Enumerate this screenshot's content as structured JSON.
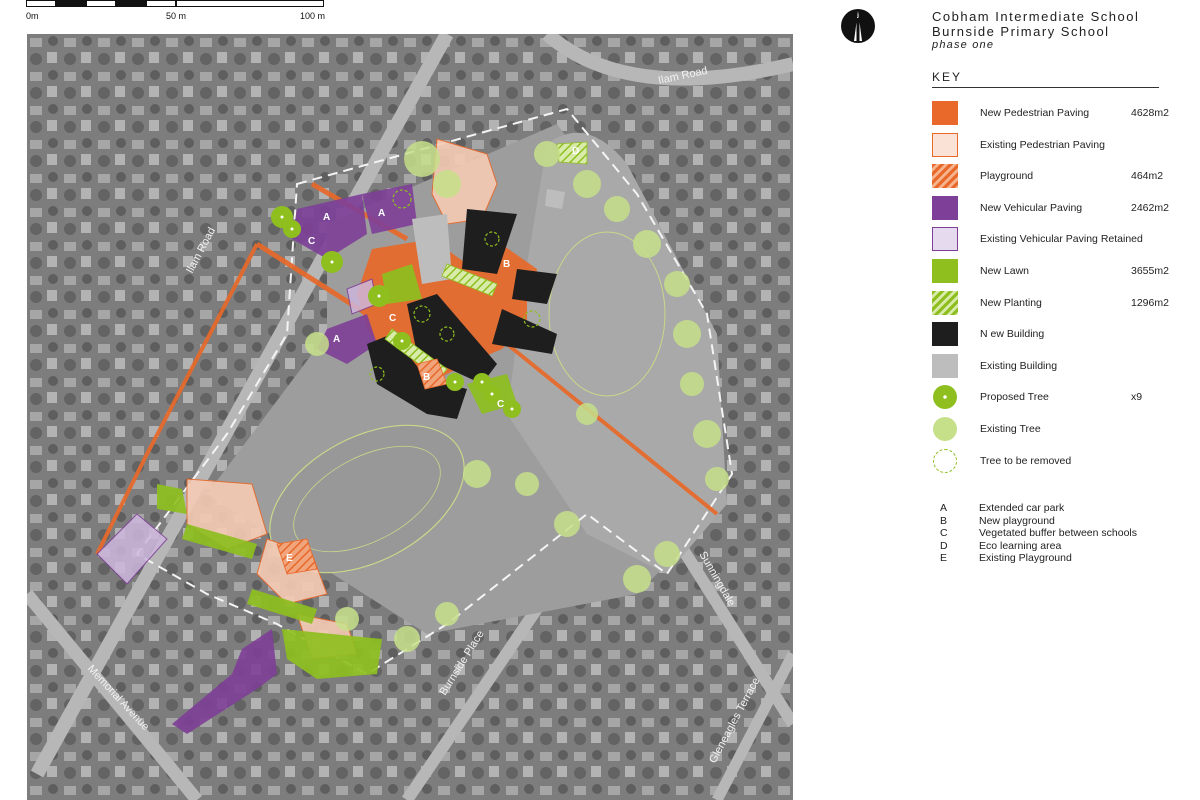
{
  "scale_bar": {
    "labels": [
      "0m",
      "50 m",
      "100 m"
    ]
  },
  "north_label": "N",
  "title": {
    "line1": "Cobham Intermediate School",
    "line2": "Burnside Primary School",
    "phase": "phase one"
  },
  "key": {
    "heading": "KEY",
    "items": [
      {
        "label": "New Pedestrian Paving",
        "value": "4628m2",
        "color": "#e8692a",
        "icon": "solid-swatch"
      },
      {
        "label": "Existing Pedestrian Paving",
        "value": "",
        "color": "#fbe2d6",
        "border": "#e8692a",
        "icon": "outlined-swatch"
      },
      {
        "label": "Playground",
        "value": "464m2",
        "color": "#e8692a",
        "icon": "hatched-swatch"
      },
      {
        "label": "New Vehicular Paving",
        "value": "2462m2",
        "color": "#7e3f98",
        "icon": "solid-swatch"
      },
      {
        "label": "Existing Vehicular Paving Retained",
        "value": "",
        "color": "#e6dbee",
        "border": "#7e3f98",
        "icon": "outlined-swatch"
      },
      {
        "label": "New Lawn",
        "value": "3655m2",
        "color": "#8ebf1f",
        "icon": "solid-swatch"
      },
      {
        "label": "New Planting",
        "value": "1296m2",
        "color": "#8ebf1f",
        "icon": "hatched-swatch"
      },
      {
        "label": "N ew Building",
        "value": "",
        "color": "#1e1e1e",
        "icon": "solid-swatch"
      },
      {
        "label": "Existing Building",
        "value": "",
        "color": "#bdbdbd",
        "icon": "solid-swatch"
      },
      {
        "label": "Proposed Tree",
        "value": "x9",
        "color": "#8ebf1f",
        "icon": "proposed-tree-circle"
      },
      {
        "label": "Existing Tree",
        "value": "",
        "color": "#c6e08a",
        "icon": "existing-tree-circle"
      },
      {
        "label": "Tree to be removed",
        "value": "",
        "color": "#8ebf1f",
        "icon": "dashed-tree-circle"
      }
    ]
  },
  "notes": [
    {
      "letter": "A",
      "text": "Extended car park"
    },
    {
      "letter": "B",
      "text": "New playground"
    },
    {
      "letter": "C",
      "text": "Vegetated buffer between schools"
    },
    {
      "letter": "D",
      "text": "Eco learning area"
    },
    {
      "letter": "E",
      "text": "Existing Playground"
    }
  ],
  "map_labels": [
    "Ilam Road",
    "Ilam Road",
    "Burnside Place",
    "Sunningdale",
    "Gleneagles Terrace",
    "Memorial Avenue"
  ],
  "map_markers": [
    "A",
    "A",
    "A",
    "B",
    "B",
    "C",
    "C",
    "C",
    "D",
    "E"
  ]
}
